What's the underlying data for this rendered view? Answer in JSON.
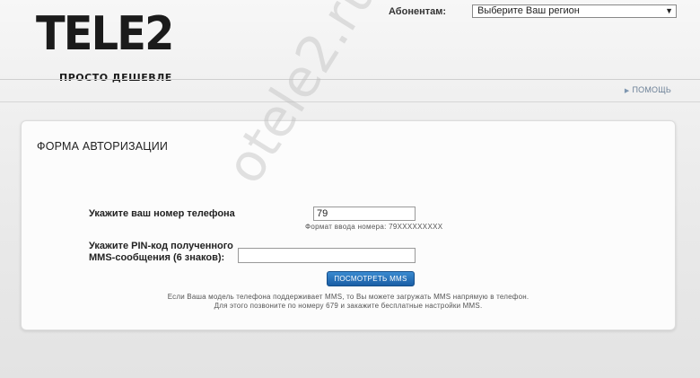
{
  "header": {
    "logo_text": "TELE2",
    "tagline": "ПРОСТО ДЕШЕВЛЕ",
    "subscribers_label": "Абонентам:",
    "region_select": {
      "selected": "Выберите Ваш регион",
      "arrow": "▼"
    },
    "help_label": "ПОМОЩЬ"
  },
  "form": {
    "title": "ФОРМА АВТОРИЗАЦИИ",
    "phone": {
      "label": "Укажите ваш номер телефона",
      "value": "79",
      "hint": "Формат ввода номера: 79XXXXXXXXX"
    },
    "pin": {
      "label_line1": "Укажите PIN-код полученного",
      "label_line2": "MMS-сообщения (6 знаков):",
      "value": ""
    },
    "submit_label": "ПОСМОТРЕТЬ MMS",
    "note_line1": "Если Ваша модель телефона поддерживает MMS, то Вы можете загружать MMS напрямую в телефон.",
    "note_line2": "Для этого позвоните по номеру 679 и закажите бесплатные настройки MMS."
  },
  "watermark": "otele2.ru",
  "colors": {
    "button": "#1a5ea5",
    "help_link": "#6a7f96"
  }
}
